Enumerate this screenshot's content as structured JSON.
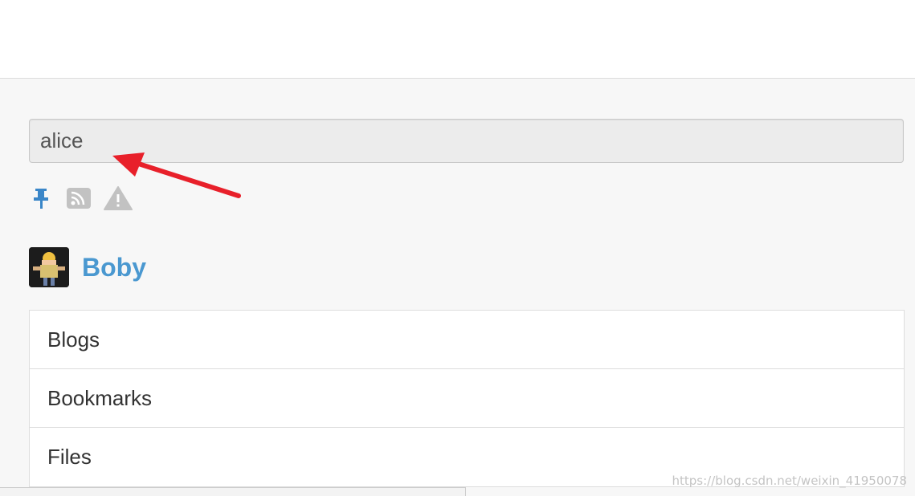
{
  "search": {
    "value": "alice"
  },
  "toolbar": {
    "icons": [
      "pin-icon",
      "rss-icon",
      "warning-icon"
    ],
    "accent_color": "#3a86c8",
    "muted_color": "#c2c2c2"
  },
  "profile": {
    "name": "Boby",
    "name_color": "#4a98d0"
  },
  "menu": {
    "items": [
      {
        "label": "Blogs"
      },
      {
        "label": "Bookmarks"
      },
      {
        "label": "Files"
      }
    ]
  },
  "annotation": {
    "color": "#e8202a"
  },
  "watermark": "https://blog.csdn.net/weixin_41950078"
}
